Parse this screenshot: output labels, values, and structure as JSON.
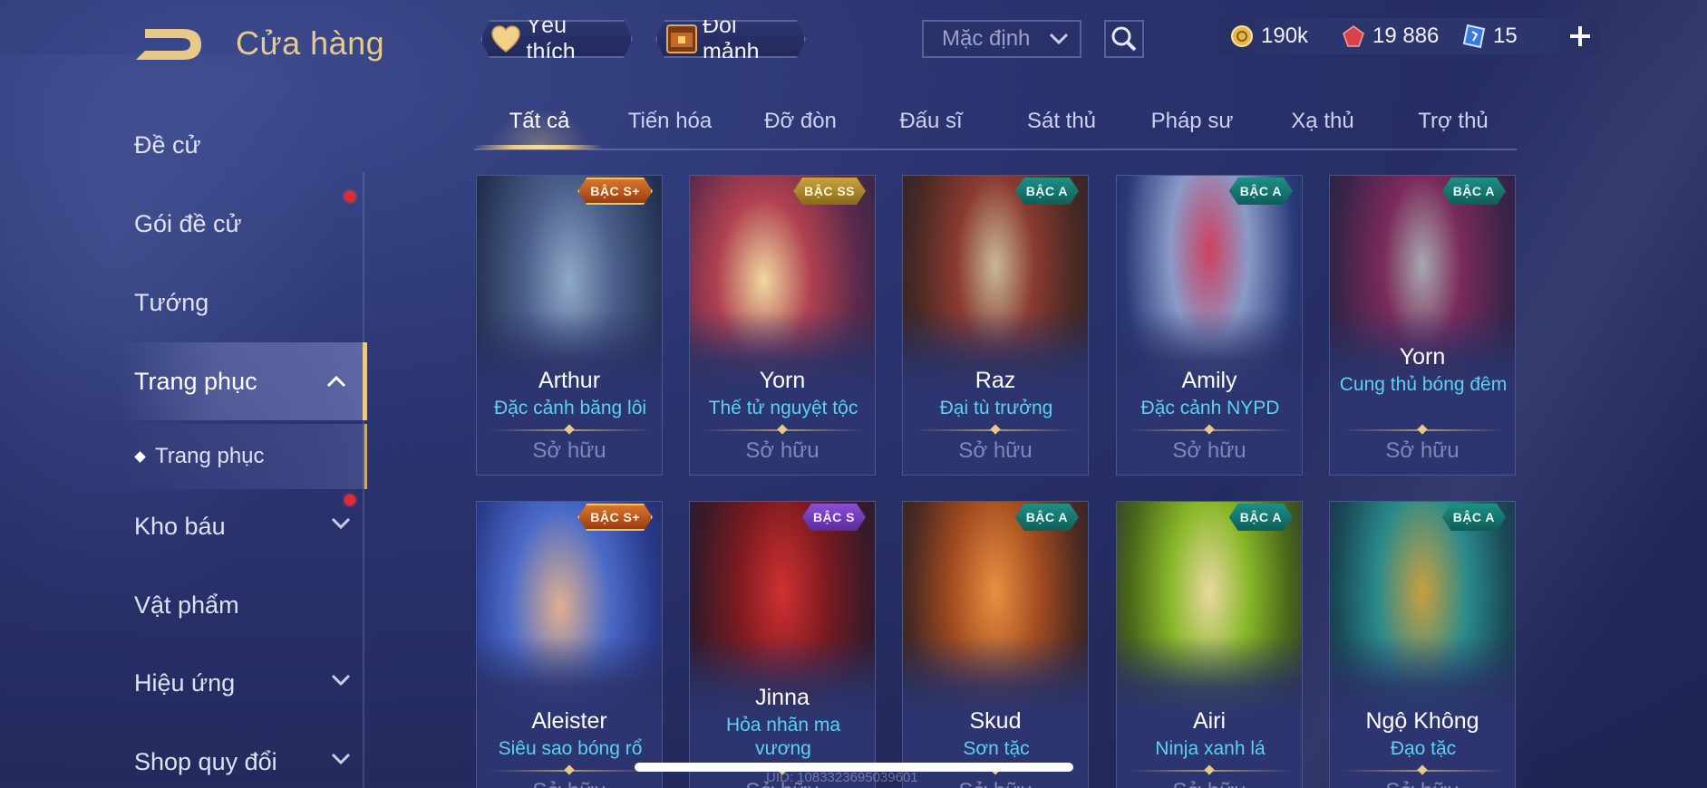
{
  "header": {
    "title": "Cửa hàng",
    "favorites_label": "Yêu thích",
    "exchange_label": "Đổi mảnh",
    "sort_value": "Mặc định",
    "currency": {
      "gold": "190k",
      "gems": "19 886",
      "tickets": "15",
      "add": "+"
    }
  },
  "sidebar": {
    "items": [
      {
        "label": "Đề cử"
      },
      {
        "label": "Gói đề cử"
      },
      {
        "label": "Tướng"
      },
      {
        "label": "Trang phục"
      },
      {
        "label": "Trang phục"
      },
      {
        "label": "Kho báu"
      },
      {
        "label": "Vật phẩm"
      },
      {
        "label": "Hiệu ứng"
      },
      {
        "label": "Shop quy đổi"
      }
    ]
  },
  "tabs": [
    "Tất cả",
    "Tiến hóa",
    "Đỡ đòn",
    "Đấu sĩ",
    "Sát thủ",
    "Pháp sư",
    "Xạ thủ",
    "Trợ thủ"
  ],
  "owned_label": "Sở hữu",
  "cards": [
    {
      "rank": "BẬC S+",
      "hero": "Arthur",
      "skin": "Đặc cảnh băng lôi"
    },
    {
      "rank": "BẬC SS",
      "hero": "Yorn",
      "skin": "Thế tử nguyệt tộc"
    },
    {
      "rank": "BẬC A",
      "hero": "Raz",
      "skin": "Đại tù trưởng"
    },
    {
      "rank": "BẬC A",
      "hero": "Amily",
      "skin": "Đặc cảnh NYPD"
    },
    {
      "rank": "BẬC A",
      "hero": "Yorn",
      "skin": "Cung thủ bóng đêm"
    },
    {
      "rank": "BẬC S+",
      "hero": "Aleister",
      "skin": "Siêu sao bóng rổ"
    },
    {
      "rank": "BẬC S",
      "hero": "Jinna",
      "skin": "Hỏa nhãn ma vương"
    },
    {
      "rank": "BẬC A",
      "hero": "Skud",
      "skin": "Sơn tặc"
    },
    {
      "rank": "BẬC A",
      "hero": "Airi",
      "skin": "Ninja xanh lá"
    },
    {
      "rank": "BẬC A",
      "hero": "Ngộ Không",
      "skin": "Đạo tặc"
    }
  ],
  "footer": {
    "uid": "UID: 1083323695039601"
  },
  "colors": {
    "accent_gold": "#e7c98a",
    "skin_name": "#5fd0f2",
    "badge_red": "#e02b35"
  }
}
